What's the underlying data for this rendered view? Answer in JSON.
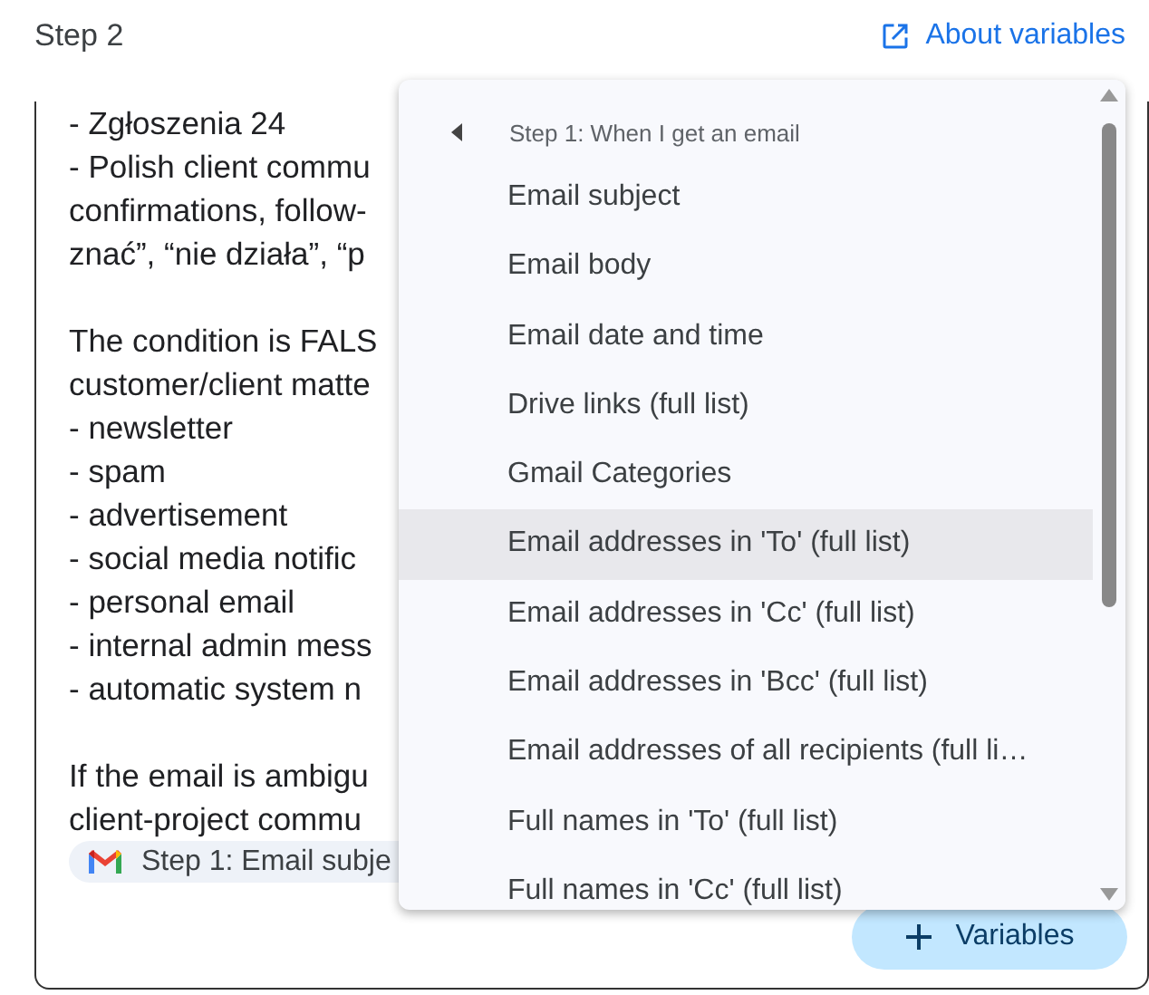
{
  "header": {
    "title": "Step 2",
    "link": "About variables"
  },
  "editor": {
    "paragraphs": [
      [
        "- Zgłoszenia 24",
        "- Polish client commu",
        "confirmations, follow-",
        "znać”, “nie działa”, “p"
      ],
      [
        "The condition is FALS",
        "customer/client matte",
        "- newsletter",
        "- spam",
        "- advertisement",
        "- social media notific",
        "- personal email",
        "- internal admin mess",
        "- automatic system n"
      ],
      [
        "If the email is ambigu",
        "client-project commu"
      ]
    ],
    "chip": "Step 1: Email subje"
  },
  "menu": {
    "items": [
      {
        "kind": "back",
        "label": "Step 1: When I get an email",
        "highlighted": false
      },
      {
        "kind": "option",
        "label": "Email subject",
        "highlighted": false
      },
      {
        "kind": "option",
        "label": "Email body",
        "highlighted": false
      },
      {
        "kind": "option",
        "label": "Email date and time",
        "highlighted": false
      },
      {
        "kind": "option",
        "label": "Drive links (full list)",
        "highlighted": false
      },
      {
        "kind": "option",
        "label": "Gmail Categories",
        "highlighted": false
      },
      {
        "kind": "option",
        "label": "Email addresses in 'To' (full list)",
        "highlighted": true
      },
      {
        "kind": "option",
        "label": "Email addresses in 'Cc' (full list)",
        "highlighted": false
      },
      {
        "kind": "option",
        "label": "Email addresses in 'Bcc' (full list)",
        "highlighted": false
      },
      {
        "kind": "option",
        "label": "Email addresses of all recipients (full li…",
        "highlighted": false
      },
      {
        "kind": "option",
        "label": "Full names in 'To' (full list)",
        "highlighted": false
      },
      {
        "kind": "option",
        "label": "Full names in 'Cc' (full list)",
        "highlighted": false
      }
    ]
  },
  "button": {
    "label": "Variables"
  }
}
